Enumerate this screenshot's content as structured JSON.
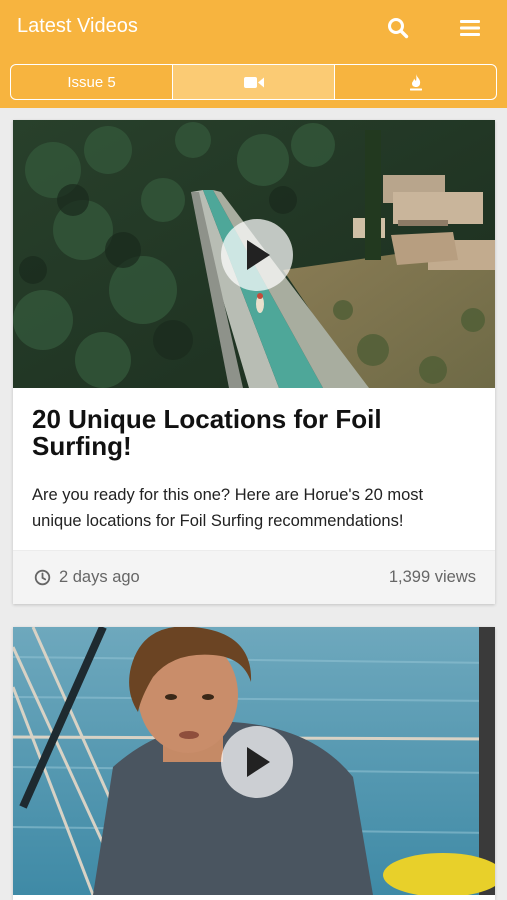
{
  "header": {
    "title": "Latest Videos",
    "search_icon": "search-icon",
    "menu_icon": "hamburger-menu-icon",
    "background_color": "#f7b43f"
  },
  "tabs": [
    {
      "label": "Issue 5",
      "active": false
    },
    {
      "icon": "video-camera-icon",
      "active": true
    },
    {
      "icon": "fire-icon",
      "active": false
    }
  ],
  "videos": [
    {
      "title": "20 Unique Locations for Foil Surfing!",
      "description": "Are you ready for this one? Here are Horue's 20 most unique locations for Foil Surfing recommendations!",
      "time_ago": "2 days ago",
      "views": "1,399 views",
      "thumbnail": "aerial-canal-forest-image",
      "play_icon": "play-icon"
    },
    {
      "thumbnail": "man-on-sailboat-image",
      "play_icon": "play-icon"
    }
  ]
}
